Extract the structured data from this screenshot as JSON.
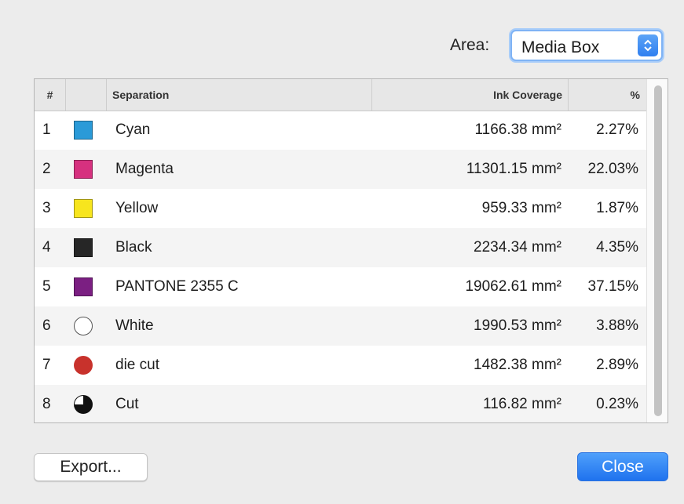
{
  "area": {
    "label": "Area:",
    "selected": "Media Box"
  },
  "table": {
    "headers": {
      "num": "#",
      "swatch": "",
      "separation": "Separation",
      "ink": "Ink Coverage",
      "pct": "%"
    },
    "rows": [
      {
        "num": "1",
        "name": "Cyan",
        "ink": "1166.38 mm²",
        "pct": "2.27%",
        "swatch": {
          "shape": "square",
          "color": "#2a9ad8"
        }
      },
      {
        "num": "2",
        "name": "Magenta",
        "ink": "11301.15 mm²",
        "pct": "22.03%",
        "swatch": {
          "shape": "square",
          "color": "#d6317f"
        }
      },
      {
        "num": "3",
        "name": "Yellow",
        "ink": "959.33 mm²",
        "pct": "1.87%",
        "swatch": {
          "shape": "square",
          "color": "#f7e51e"
        }
      },
      {
        "num": "4",
        "name": "Black",
        "ink": "2234.34 mm²",
        "pct": "4.35%",
        "swatch": {
          "shape": "square",
          "color": "#262626"
        }
      },
      {
        "num": "5",
        "name": "PANTONE 2355 C",
        "ink": "19062.61 mm²",
        "pct": "37.15%",
        "swatch": {
          "shape": "square",
          "color": "#7b1f82"
        }
      },
      {
        "num": "6",
        "name": "White",
        "ink": "1990.53 mm²",
        "pct": "3.88%",
        "swatch": {
          "shape": "circle-outline",
          "color": "#ffffff"
        }
      },
      {
        "num": "7",
        "name": "die cut",
        "ink": "1482.38 mm²",
        "pct": "2.89%",
        "swatch": {
          "shape": "circle",
          "color": "#c8322c"
        }
      },
      {
        "num": "8",
        "name": "Cut",
        "ink": "116.82 mm²",
        "pct": "0.23%",
        "swatch": {
          "shape": "circle-mixed",
          "color": "#111111"
        }
      }
    ]
  },
  "buttons": {
    "export": "Export...",
    "close": "Close"
  },
  "colors": {
    "accent": "#2f7ff0",
    "row_alt": "#f4f4f4"
  }
}
